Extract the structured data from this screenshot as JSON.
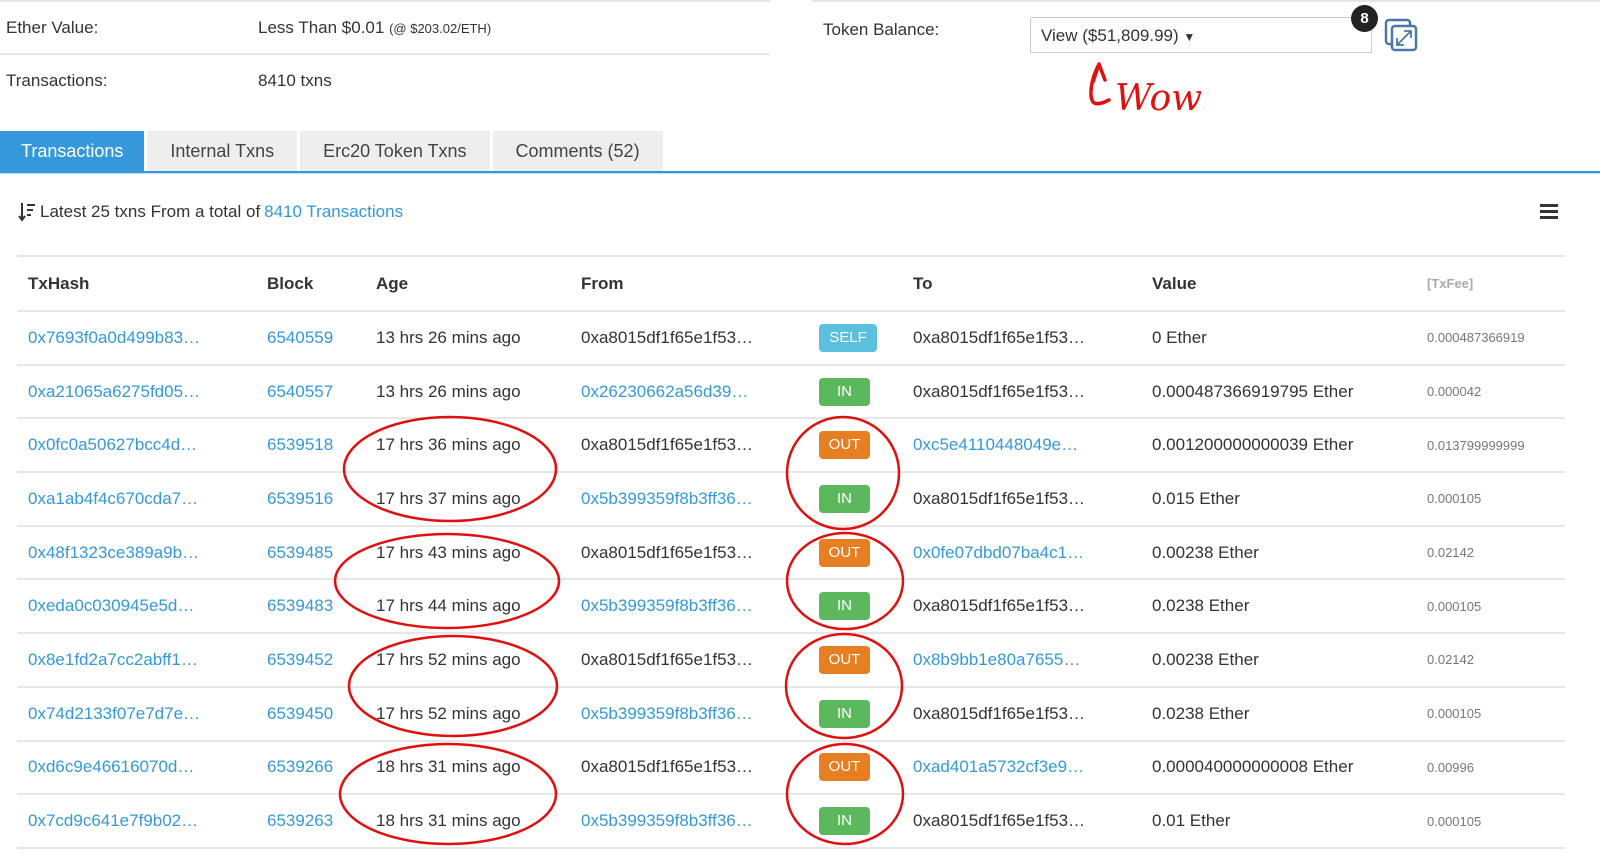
{
  "overview": {
    "ether_value_label": "Ether Value:",
    "ether_value": "Less Than $0.01",
    "ether_price": "(@ $203.02/ETH)",
    "transactions_label": "Transactions:",
    "transactions_value": "8410 txns",
    "token_balance_label": "Token Balance:",
    "token_balance_select": "View ($51,809.99)",
    "token_count_badge": "8"
  },
  "annotation": {
    "text": "Wow!",
    "color": "#e01010"
  },
  "tabs": [
    {
      "label": "Transactions",
      "active": true
    },
    {
      "label": "Internal Txns"
    },
    {
      "label": "Erc20 Token Txns"
    },
    {
      "label": "Comments (52)"
    }
  ],
  "summary": {
    "prefix": "Latest 25 txns From a total of",
    "link": "8410 Transactions"
  },
  "table": {
    "headers": {
      "txhash": "TxHash",
      "block": "Block",
      "age": "Age",
      "from": "From",
      "to": "To",
      "value": "Value",
      "fee": "[TxFee]"
    },
    "rows": [
      {
        "hash": "0x7693f0a0d499b83…",
        "block": "6540559",
        "age": "13 hrs 26 mins ago",
        "from": "0xa8015df1f65e1f53…",
        "from_link": false,
        "dir": "SELF",
        "to": "0xa8015df1f65e1f53…",
        "to_link": false,
        "value": "0 Ether",
        "fee": "0.000487366919"
      },
      {
        "hash": "0xa21065a6275fd05…",
        "block": "6540557",
        "age": "13 hrs 26 mins ago",
        "from": "0x26230662a56d39…",
        "from_link": true,
        "dir": "IN",
        "to": "0xa8015df1f65e1f53…",
        "to_link": false,
        "value": "0.000487366919795 Ether",
        "fee": "0.000042"
      },
      {
        "hash": "0x0fc0a50627bcc4d…",
        "block": "6539518",
        "age": "17 hrs 36 mins ago",
        "from": "0xa8015df1f65e1f53…",
        "from_link": false,
        "dir": "OUT",
        "to": "0xc5e4110448049e…",
        "to_link": true,
        "value": "0.001200000000039 Ether",
        "fee": "0.013799999999"
      },
      {
        "hash": "0xa1ab4f4c670cda7…",
        "block": "6539516",
        "age": "17 hrs 37 mins ago",
        "from": "0x5b399359f8b3ff36…",
        "from_link": true,
        "dir": "IN",
        "to": "0xa8015df1f65e1f53…",
        "to_link": false,
        "value": "0.015 Ether",
        "fee": "0.000105"
      },
      {
        "hash": "0x48f1323ce389a9b…",
        "block": "6539485",
        "age": "17 hrs 43 mins ago",
        "from": "0xa8015df1f65e1f53…",
        "from_link": false,
        "dir": "OUT",
        "to": "0x0fe07dbd07ba4c1…",
        "to_link": true,
        "value": "0.00238 Ether",
        "fee": "0.02142"
      },
      {
        "hash": "0xeda0c030945e5d…",
        "block": "6539483",
        "age": "17 hrs 44 mins ago",
        "from": "0x5b399359f8b3ff36…",
        "from_link": true,
        "dir": "IN",
        "to": "0xa8015df1f65e1f53…",
        "to_link": false,
        "value": "0.0238 Ether",
        "fee": "0.000105"
      },
      {
        "hash": "0x8e1fd2a7cc2abff1…",
        "block": "6539452",
        "age": "17 hrs 52 mins ago",
        "from": "0xa8015df1f65e1f53…",
        "from_link": false,
        "dir": "OUT",
        "to": "0x8b9bb1e80a7655…",
        "to_link": true,
        "value": "0.00238 Ether",
        "fee": "0.02142"
      },
      {
        "hash": "0x74d2133f07e7d7e…",
        "block": "6539450",
        "age": "17 hrs 52 mins ago",
        "from": "0x5b399359f8b3ff36…",
        "from_link": true,
        "dir": "IN",
        "to": "0xa8015df1f65e1f53…",
        "to_link": false,
        "value": "0.0238 Ether",
        "fee": "0.000105"
      },
      {
        "hash": "0xd6c9e46616070d…",
        "block": "6539266",
        "age": "18 hrs 31 mins ago",
        "from": "0xa8015df1f65e1f53…",
        "from_link": false,
        "dir": "OUT",
        "to": "0xad401a5732cf3e9…",
        "to_link": true,
        "value": "0.000040000000008 Ether",
        "fee": "0.00996"
      },
      {
        "hash": "0x7cd9c641e7f9b02…",
        "block": "6539263",
        "age": "18 hrs 31 mins ago",
        "from": "0x5b399359f8b3ff36…",
        "from_link": true,
        "dir": "IN",
        "to": "0xa8015df1f65e1f53…",
        "to_link": false,
        "value": "0.01 Ether",
        "fee": "0.000105"
      }
    ]
  }
}
